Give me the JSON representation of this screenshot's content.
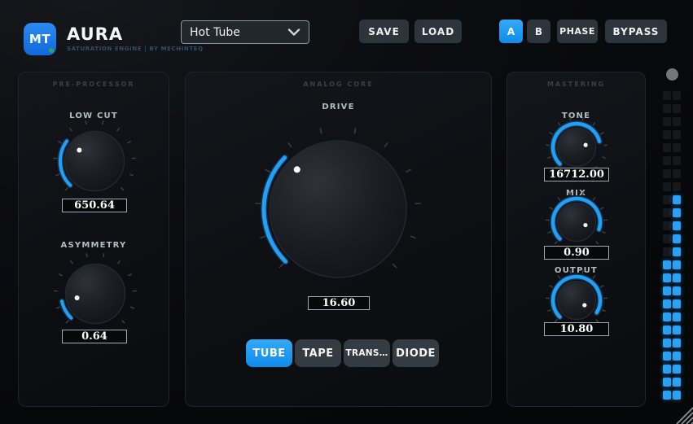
{
  "header": {
    "logo_text": "MT",
    "title": "AURA",
    "subtitle": "SATURATION ENGINE | BY MECHINTEQ",
    "preset_selector": {
      "value": "Hot Tube"
    },
    "buttons": {
      "save": "SAVE",
      "load": "LOAD",
      "a": "A",
      "b": "B",
      "phase": "PHASE",
      "bypass": "BYPASS"
    },
    "a_active": true,
    "b_active": false
  },
  "left_panel": {
    "title": "PRE-PROCESSOR",
    "knobs": [
      {
        "label": "LOW CUT",
        "value": "650.64",
        "fraction": 0.3
      },
      {
        "label": "ASYMMETRY",
        "value": "0.64",
        "fraction": 0.12
      }
    ]
  },
  "center_panel": {
    "title": "ANALOG CORE",
    "knob": {
      "label": "DRIVE",
      "value": "16.60",
      "fraction": 0.33
    },
    "modes": [
      {
        "label": "TUBE",
        "active": true
      },
      {
        "label": "TAPE",
        "active": false
      },
      {
        "label": "TRANS…",
        "active": false
      },
      {
        "label": "DIODE",
        "active": false
      }
    ]
  },
  "right_panel": {
    "title": "MASTERING",
    "knobs": [
      {
        "label": "TONE",
        "value": "16712.00",
        "fraction": 0.78
      },
      {
        "label": "MIX",
        "value": "0.90",
        "fraction": 0.9
      },
      {
        "label": "OUTPUT",
        "value": "10.80",
        "fraction": 0.95
      }
    ]
  },
  "meter": {
    "rows": 24,
    "left_lit": 11,
    "right_lit": 16
  },
  "colors": {
    "accent": "#239ff5",
    "led": "#2aa1f4",
    "logo_blue": "#1778e8",
    "status_green": "#35a05f"
  }
}
